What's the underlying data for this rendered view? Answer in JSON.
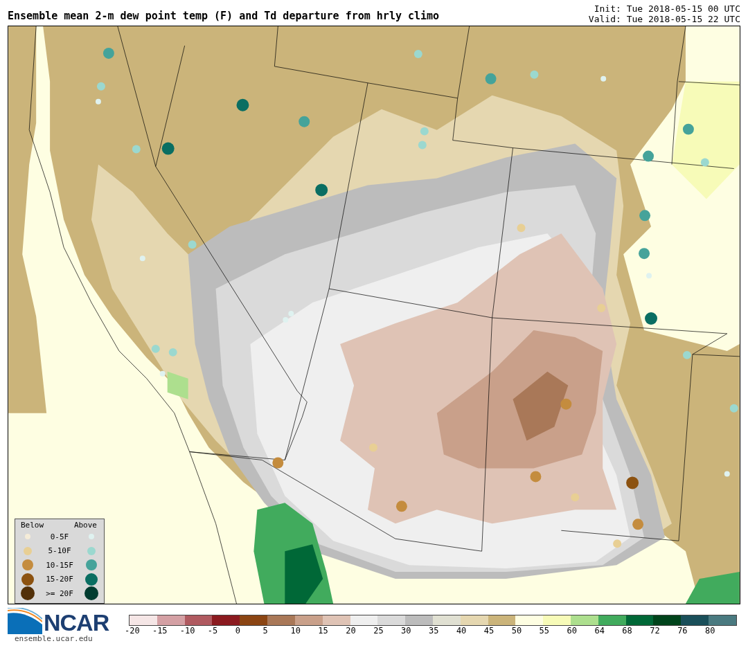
{
  "header": {
    "title": "Ensemble mean 2-m dew point temp (F) and Td departure from hrly climo",
    "init": "Init: Tue 2018-05-15 00 UTC",
    "valid": "Valid: Tue 2018-05-15 22 UTC"
  },
  "legend": {
    "headers": [
      "Below",
      "Above"
    ],
    "rows": [
      {
        "label": "0-5F",
        "below": {
          "color": "#f5ecd8"
        },
        "above": {
          "color": "#dff2f0"
        }
      },
      {
        "label": "5-10F",
        "below": {
          "color": "#e8cf94"
        },
        "above": {
          "color": "#9bd8cf"
        }
      },
      {
        "label": "10-15F",
        "below": {
          "color": "#c48c3e"
        },
        "above": {
          "color": "#45a39a"
        }
      },
      {
        "label": "15-20F",
        "below": {
          "color": "#8c5210"
        },
        "above": {
          "color": "#0a6e62"
        }
      },
      {
        "label": ">= 20F",
        "below": {
          "color": "#523009"
        },
        "above": {
          "color": "#003c30"
        }
      }
    ]
  },
  "footer": {
    "logo_text": "NCAR",
    "site": "ensemble.ucar.edu"
  },
  "colorbar": {
    "bins": [
      {
        "color": "#f5e6e6",
        "tick": "-20"
      },
      {
        "color": "#d4a0a4",
        "tick": "-15"
      },
      {
        "color": "#b05a60",
        "tick": "-10"
      },
      {
        "color": "#8b1a1f",
        "tick": "-5"
      },
      {
        "color": "#8b4513",
        "tick": "0"
      },
      {
        "color": "#a97858",
        "tick": "5"
      },
      {
        "color": "#c9a08a",
        "tick": "10"
      },
      {
        "color": "#dfc3b5",
        "tick": "15"
      },
      {
        "color": "#efefef",
        "tick": "20"
      },
      {
        "color": "#dadada",
        "tick": "25"
      },
      {
        "color": "#bcbcbc",
        "tick": "30"
      },
      {
        "color": "#e0e0d2",
        "tick": "35"
      },
      {
        "color": "#e5d7b0",
        "tick": "40"
      },
      {
        "color": "#cbb47a",
        "tick": "45"
      },
      {
        "color": "#fefee2",
        "tick": "50"
      },
      {
        "color": "#f7fbb8",
        "tick": "55"
      },
      {
        "color": "#addf8e",
        "tick": "60"
      },
      {
        "color": "#41ab5d",
        "tick": "64"
      },
      {
        "color": "#006837",
        "tick": "68"
      },
      {
        "color": "#00441b",
        "tick": "72"
      },
      {
        "color": "#1a4f5a",
        "tick": "76"
      },
      {
        "color": "#4a7a80",
        "tick": "80"
      }
    ]
  }
}
